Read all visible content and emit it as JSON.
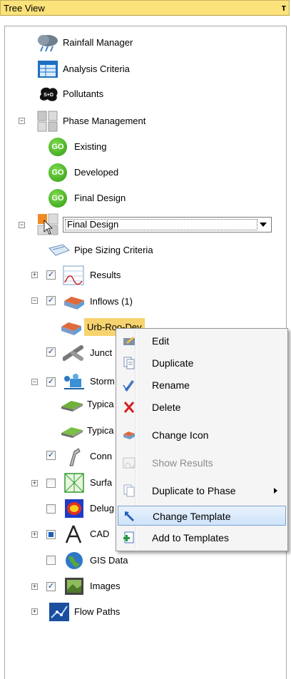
{
  "title_bar": {
    "title": "Tree View",
    "pin": "т"
  },
  "tree": {
    "rainfall": "Rainfall Manager",
    "analysis": "Analysis Criteria",
    "pollutants": "Pollutants",
    "phase_mgmt": "Phase Management",
    "phases": [
      "Existing",
      "Developed",
      "Final Design"
    ],
    "go_badge": "GO",
    "pollutant_badge": "S+D",
    "phase_combo": "Final Design",
    "pipe_sizing": "Pipe Sizing Criteria",
    "results": "Results",
    "inflows": "Inflows (1)",
    "urb": "Urb-Roo-Dev",
    "junctions": "Junct",
    "storm": "Storm",
    "typical1": "Typica",
    "typical2": "Typica",
    "conn": "Conn",
    "surf": "Surfa",
    "deluge": "Delug",
    "cad": "CAD",
    "gis": "GIS Data",
    "images": "Images",
    "flow": "Flow Paths"
  },
  "context_menu": {
    "items": [
      "Edit",
      "Duplicate",
      "Rename",
      "Delete",
      "Change Icon",
      "Show Results",
      "Duplicate to Phase",
      "Change Template",
      "Add to Templates"
    ],
    "disabled_item": "Show Results",
    "highlighted_item": "Change Template"
  },
  "colors": {
    "title_bar_bg": "#fbe27a",
    "highlight_bg": "#cfe3fa",
    "selected_node_bg": "#f7d36f"
  }
}
